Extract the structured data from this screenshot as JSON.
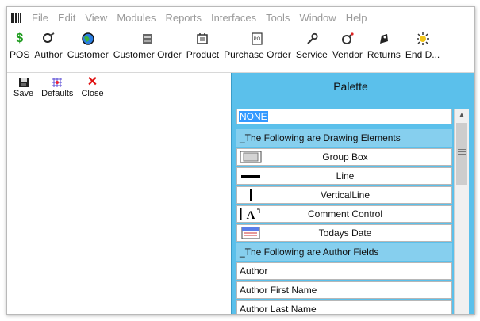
{
  "menu": {
    "items": [
      "File",
      "Edit",
      "View",
      "Modules",
      "Reports",
      "Interfaces",
      "Tools",
      "Window",
      "Help"
    ]
  },
  "toolbar": {
    "buttons": [
      {
        "label": "POS",
        "icon": "dollar-icon"
      },
      {
        "label": "Author",
        "icon": "author-icon"
      },
      {
        "label": "Customer",
        "icon": "customer-globe-icon"
      },
      {
        "label": "Customer Order",
        "icon": "customer-order-icon"
      },
      {
        "label": "Product",
        "icon": "product-icon"
      },
      {
        "label": "Purchase Order",
        "icon": "purchase-order-icon"
      },
      {
        "label": "Service",
        "icon": "service-icon"
      },
      {
        "label": "Vendor",
        "icon": "vendor-icon"
      },
      {
        "label": "Returns",
        "icon": "returns-icon"
      },
      {
        "label": "End D...",
        "icon": "end-day-icon"
      }
    ]
  },
  "editor": {
    "save_label": "Save",
    "defaults_label": "Defaults",
    "close_label": "Close"
  },
  "palette": {
    "title": "Palette",
    "selected": "NONE",
    "drawing_header": "_The Following are Drawing Elements",
    "drawing_items": [
      "Group Box",
      "Line",
      "VerticalLine",
      "Comment Control",
      "Todays Date"
    ],
    "author_header": "_The Following are Author Fields",
    "author_fields": [
      "Author",
      "Author First Name",
      "Author Last Name"
    ]
  },
  "colors": {
    "palette_bg": "#5bc0eb",
    "section_bg": "#86cfee",
    "selection": "#3399ff"
  }
}
